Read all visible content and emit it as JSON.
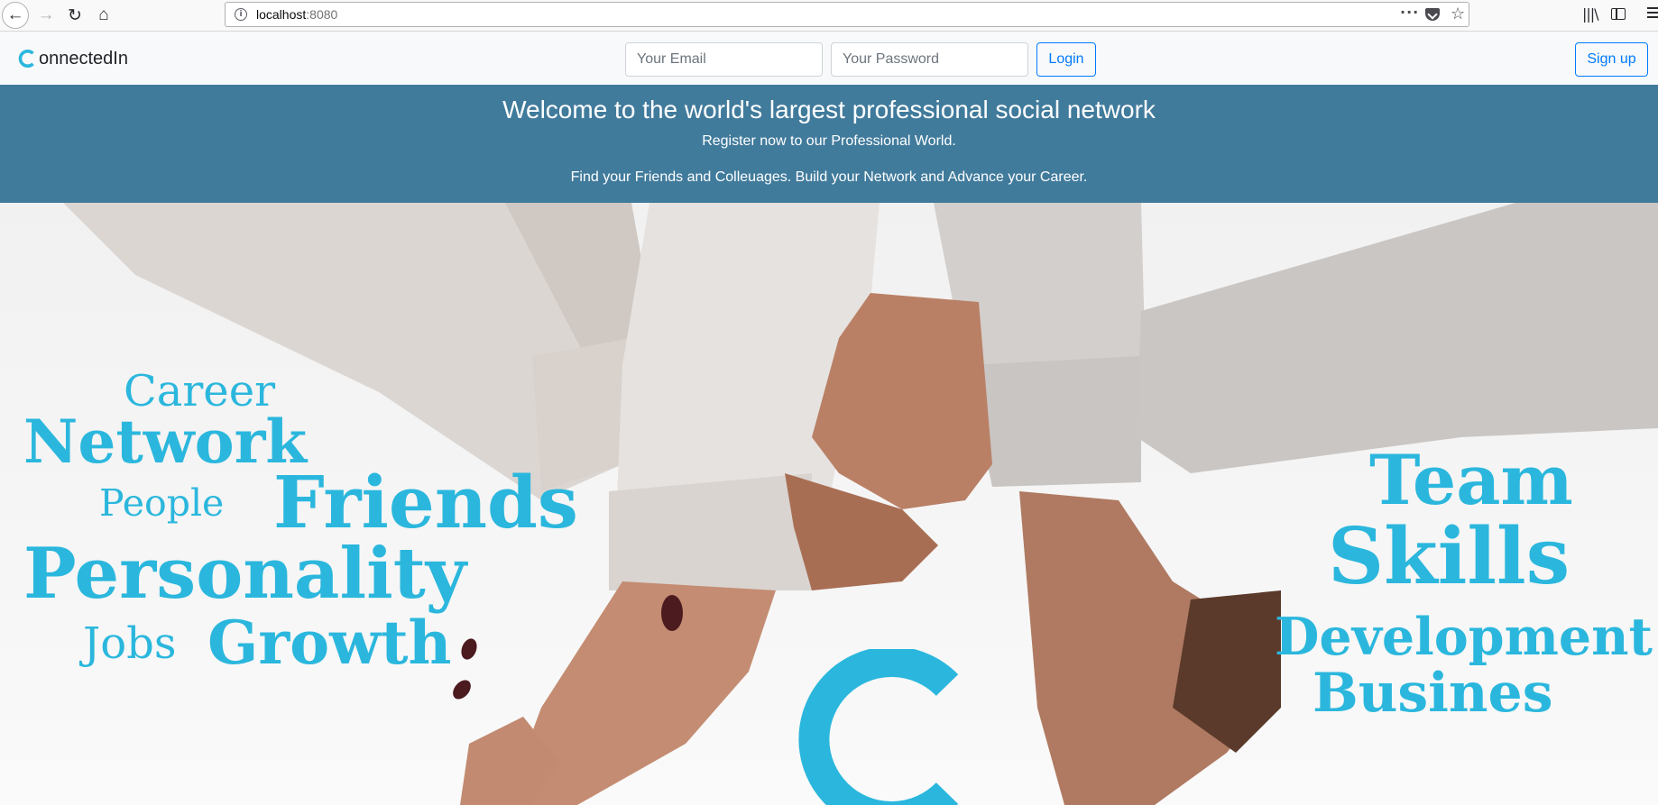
{
  "browser": {
    "url_host": "localhost",
    "url_port": ":8080"
  },
  "navbar": {
    "brand_rest": "onnectedIn",
    "email_placeholder": "Your Email",
    "password_placeholder": "Your Password",
    "login_label": "Login",
    "signup_label": "Sign up"
  },
  "banner": {
    "heading": "Welcome to the world's largest professional social network",
    "line1": "Register now to our Professional World.",
    "line2": "Find your Friends and Colleuages. Build your Network and Advance your Career."
  },
  "hero": {
    "words": {
      "career": "Career",
      "network": "Network",
      "people": "People",
      "friends": "Friends",
      "personality": "Personality",
      "jobs": "Jobs",
      "growth": "Growth",
      "team": "Team",
      "skills": "Skills",
      "development": "Development",
      "partial": "Busines",
      "logo_letter": "C"
    }
  },
  "colors": {
    "accent": "#2bb7dd",
    "banner_bg": "#417b9c",
    "link_blue": "#007bff"
  }
}
